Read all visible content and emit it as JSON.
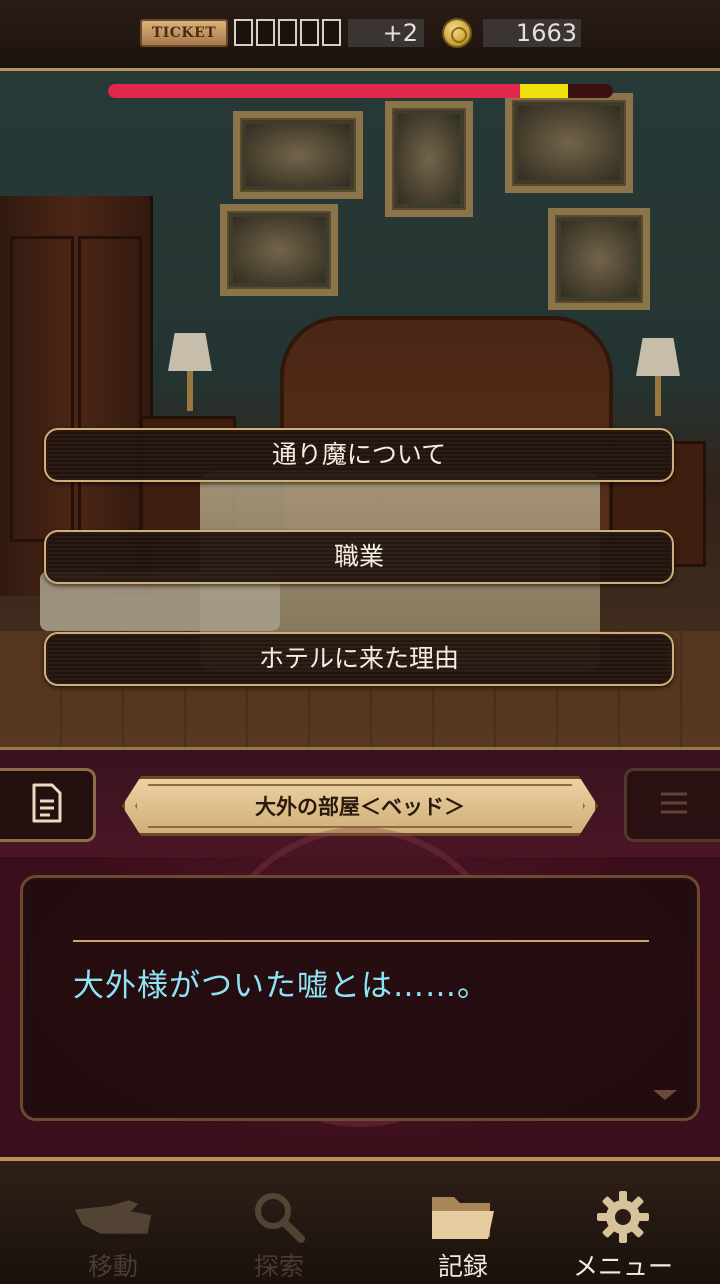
{
  "hud": {
    "ticket_label": "TICKET",
    "ticket_slots": 5,
    "ticket_bonus": "+2",
    "coin_count": "1663"
  },
  "timer": {
    "fill_fraction": 0.91,
    "color": "#e0284e",
    "warn_color": "#f2e00c"
  },
  "choices": [
    {
      "label": "通り魔について"
    },
    {
      "label": "職業"
    },
    {
      "label": "ホテルに来た理由"
    }
  ],
  "location": {
    "label": "大外の部屋＜ベッド＞"
  },
  "dialog": {
    "text": "大外様がついた嘘とは……。",
    "text_color": "#8ee4f4"
  },
  "nav": {
    "items": [
      {
        "label": "移動",
        "icon": "move-hand-icon",
        "enabled": false
      },
      {
        "label": "探索",
        "icon": "search-icon",
        "enabled": false
      },
      {
        "label": "記録",
        "icon": "folder-icon",
        "enabled": true
      },
      {
        "label": "メニュー",
        "icon": "gear-icon",
        "enabled": true
      }
    ]
  }
}
